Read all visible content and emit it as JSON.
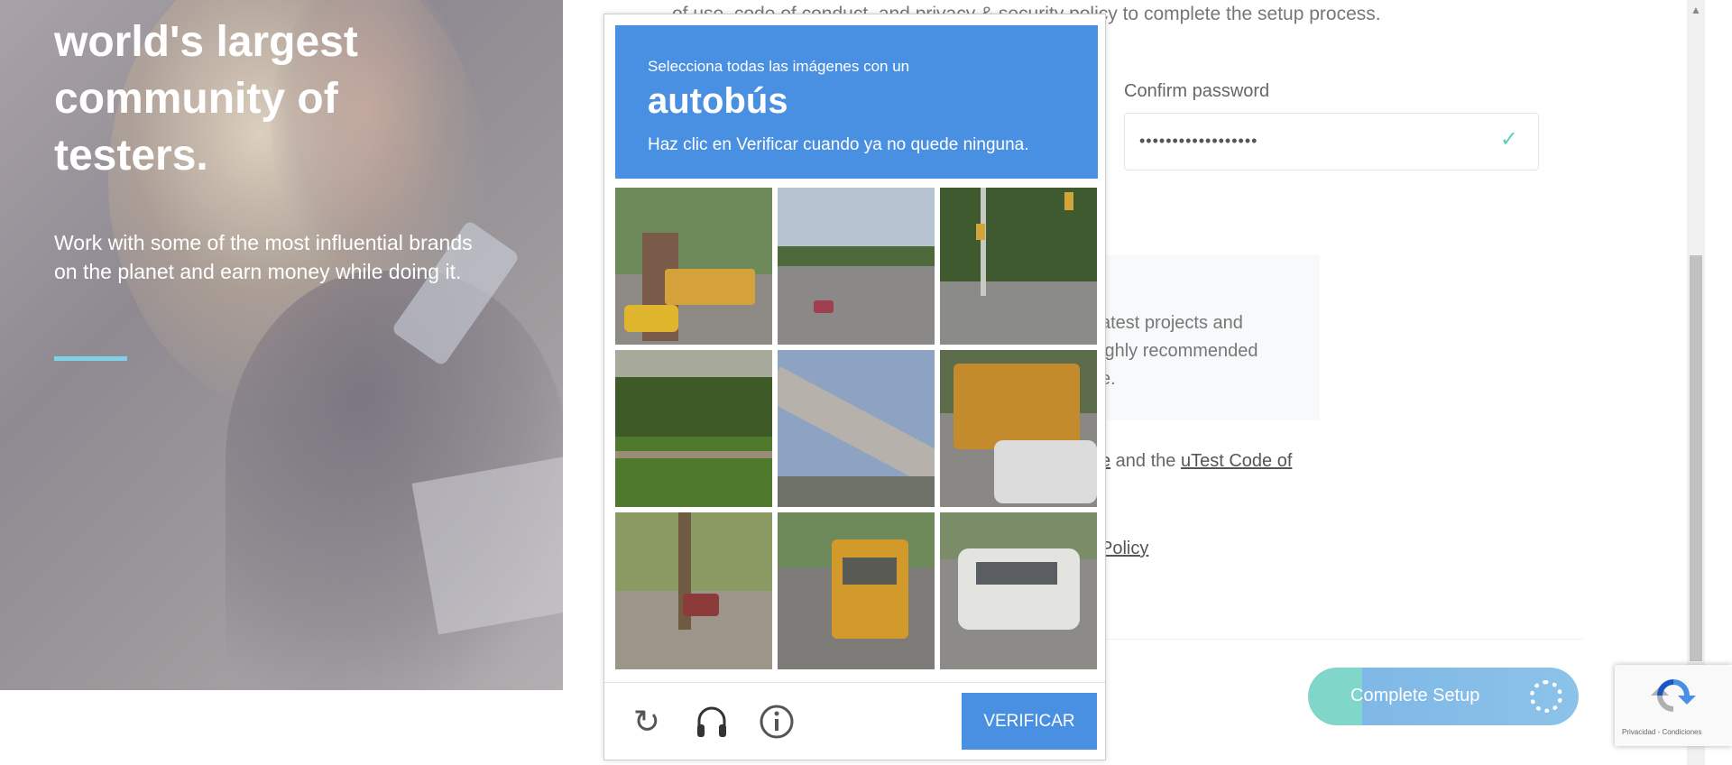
{
  "hero": {
    "title": "Welcome to the world's largest community of testers.",
    "subtitle": "Work with some of the most influential brands on the planet and earn money while doing it."
  },
  "form": {
    "top_text": "of use, code of conduct, and privacy & security policy to complete the setup process.",
    "confirm_label": "Confirm password",
    "confirm_value": "••••••••••••••••••",
    "info_line1": "atest projects and",
    "info_line2": "ighly recommended",
    "info_line3": "e.",
    "terms_prefix": "e",
    "terms_and": " and the ",
    "terms_link": "uTest Code of",
    "policy_link": "Policy",
    "complete_button": "Complete Setup"
  },
  "captcha": {
    "select_text": "Selecciona todas las imágenes con un",
    "target": "autobús",
    "hint": "Haz clic en Verificar cuando ya no quede ninguna.",
    "verify_button": "VERIFICAR",
    "tiles": [
      {
        "name": "bus-street-corner",
        "selected": false
      },
      {
        "name": "road-cars",
        "selected": false
      },
      {
        "name": "traffic-light-intersection",
        "selected": false
      },
      {
        "name": "highway-trees",
        "selected": false
      },
      {
        "name": "overpass",
        "selected": false
      },
      {
        "name": "school-bus-rear",
        "selected": false
      },
      {
        "name": "tree-lined-street",
        "selected": false
      },
      {
        "name": "school-bus-front",
        "selected": false
      },
      {
        "name": "white-suv",
        "selected": false
      }
    ]
  },
  "badge": {
    "privacy_text": "Privacidad - Condiciones"
  }
}
